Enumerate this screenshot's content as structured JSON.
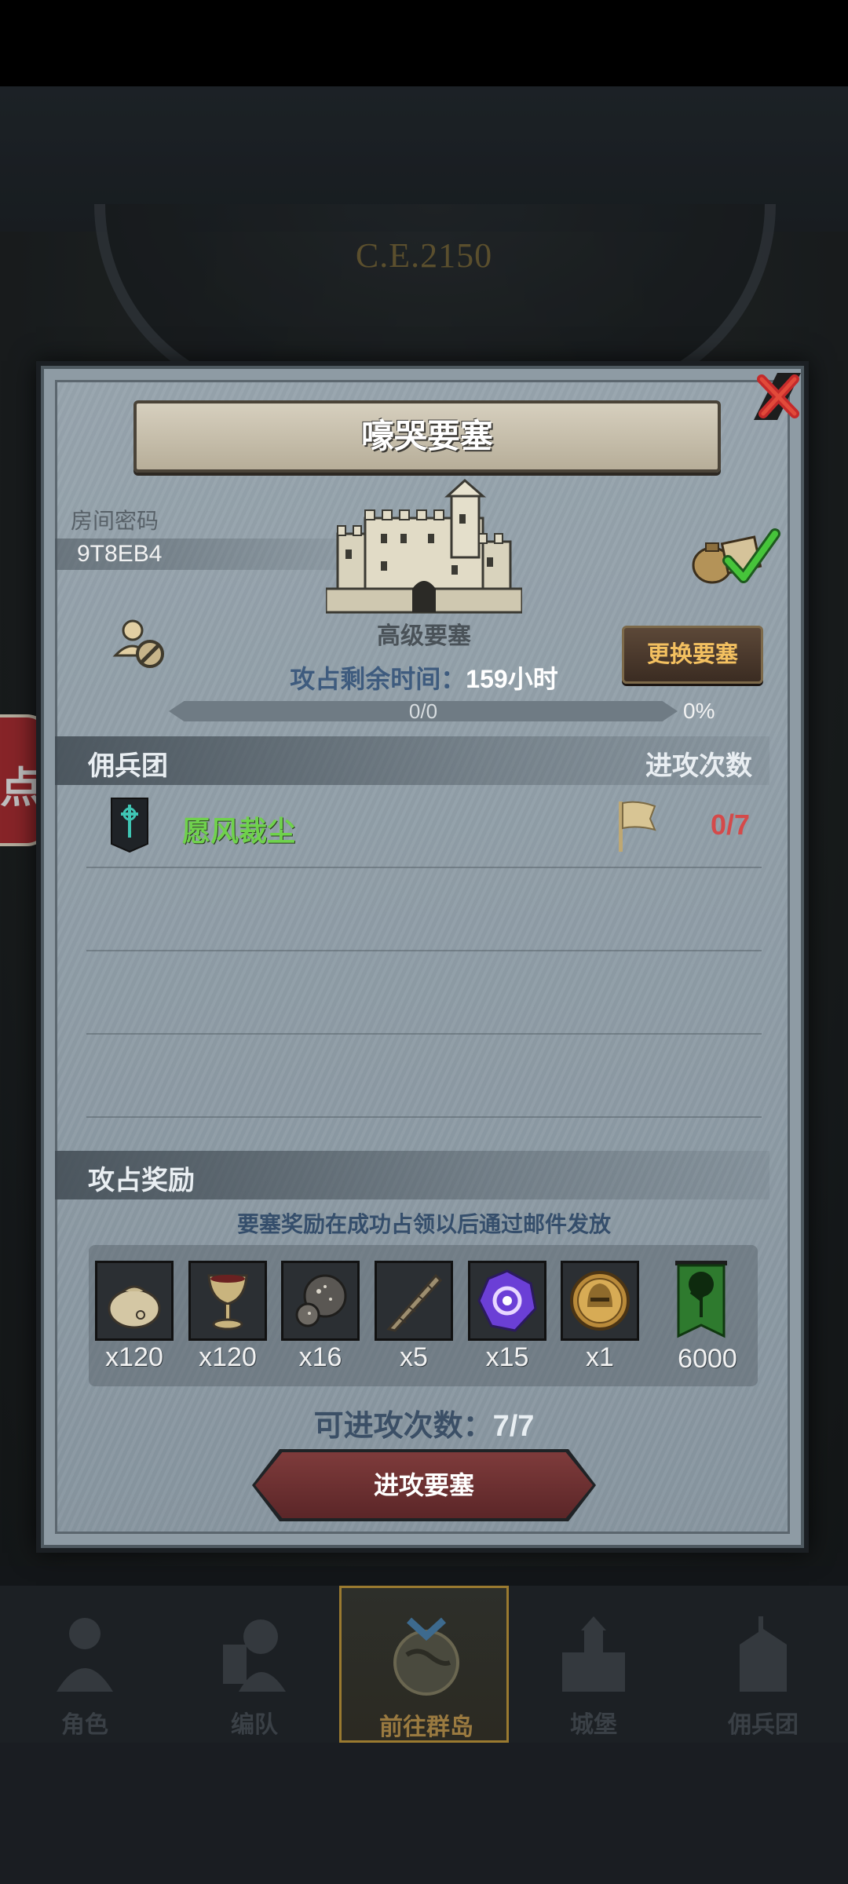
{
  "background": {
    "year": "C.E.2150",
    "side_badge": "点"
  },
  "dialog": {
    "title": "嚎哭要塞",
    "room_label": "房间密码",
    "room_code": "9T8EB4",
    "fortress_tier": "高级要塞",
    "change_button": "更换要塞",
    "occupy_time_label": "攻占剩余时间：",
    "occupy_time_value": "159小时",
    "progress_text": "0/0",
    "progress_percent": "0%",
    "progress_fraction": 0
  },
  "legion": {
    "header_left": "佣兵团",
    "header_right": "进攻次数",
    "rows": [
      {
        "name": "愿风裁尘",
        "attacks": "0/7"
      }
    ]
  },
  "rewards": {
    "title": "攻占奖励",
    "note": "要塞奖励在成功占领以后通过邮件发放",
    "items": [
      {
        "icon": "coin-bag-icon",
        "qty": "x120"
      },
      {
        "icon": "goblet-icon",
        "qty": "x120"
      },
      {
        "icon": "ore-icon",
        "qty": "x16"
      },
      {
        "icon": "horn-icon",
        "qty": "x5"
      },
      {
        "icon": "purple-gem-icon",
        "qty": "x15"
      },
      {
        "icon": "gold-helmet-medal-icon",
        "qty": "x1"
      }
    ],
    "banner_icon": "tree-banner-icon",
    "banner_qty": "6000"
  },
  "attacks_left_label": "可进攻次数：",
  "attacks_left_value": "7/7",
  "attack_button": "进攻要塞",
  "nav": [
    {
      "label": "角色",
      "icon": "knight-icon"
    },
    {
      "label": "编队",
      "icon": "formation-icon"
    },
    {
      "label": "前往群岛",
      "icon": "globe-icon",
      "active": true
    },
    {
      "label": "城堡",
      "icon": "castle-icon"
    },
    {
      "label": "佣兵团",
      "icon": "mercenary-icon"
    }
  ],
  "colors": {
    "accent_green": "#6fd24c",
    "alert_red": "#d44a4a",
    "gold": "#f3c060"
  }
}
